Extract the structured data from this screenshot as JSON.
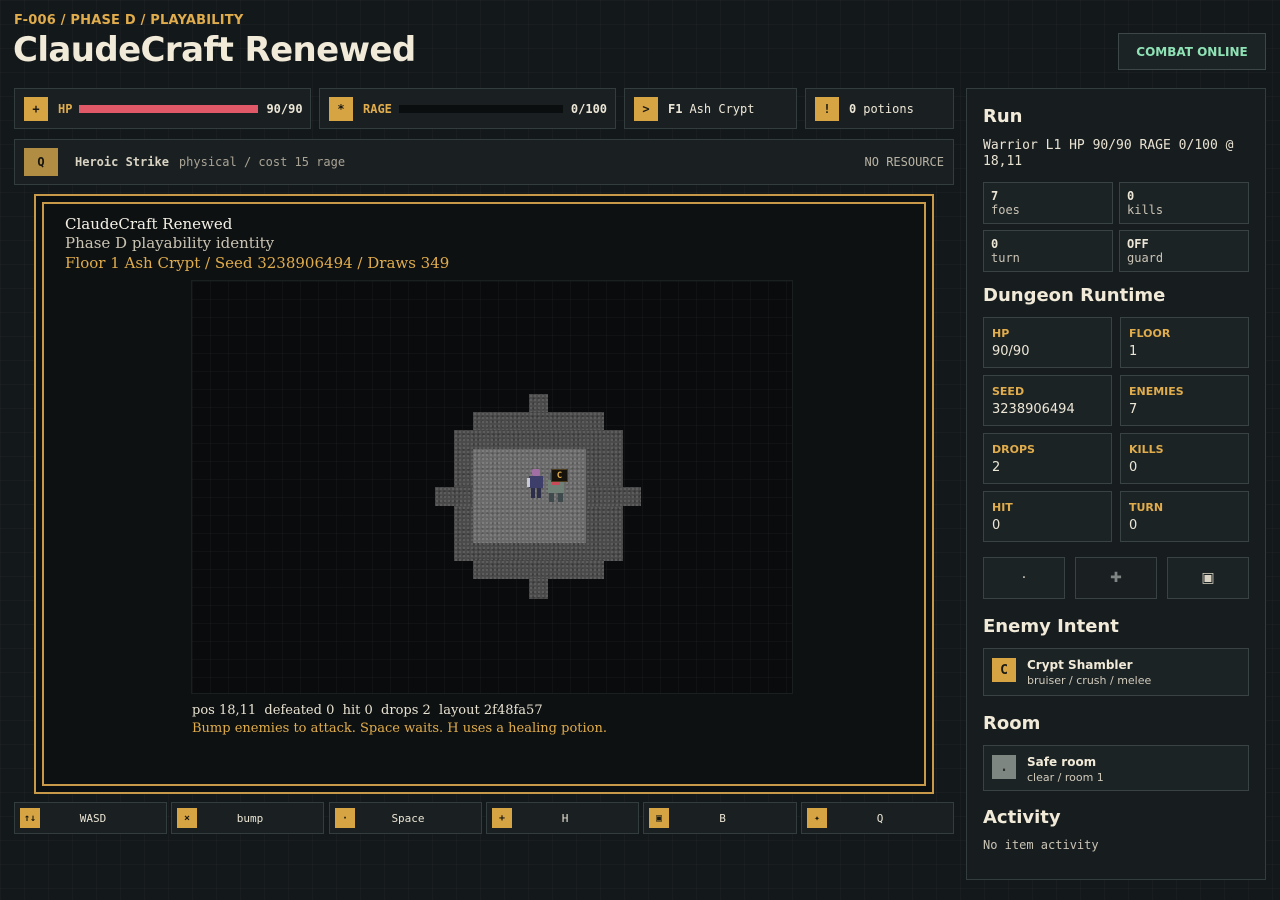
{
  "header": {
    "eyebrow": "F-006 / PHASE D / PLAYABILITY",
    "title": "ClaudeCraft Renewed",
    "status_button": "COMBAT ONLINE"
  },
  "stats": {
    "hp": {
      "badge": "+",
      "label": "HP",
      "value": "90/90",
      "fraction": 1.0,
      "color": "#e15868"
    },
    "rage": {
      "badge": "*",
      "label": "RAGE",
      "value": "0/100",
      "fraction": 0.0
    },
    "floor": {
      "badge": ">",
      "level": "F1",
      "name": "Ash Crypt"
    },
    "potions": {
      "badge": "!",
      "count": "0",
      "label": "potions"
    }
  },
  "ability": {
    "key": "Q",
    "name": "Heroic Strike",
    "detail": "physical / cost 15 rage",
    "status": "NO RESOURCE"
  },
  "viewport": {
    "title": "ClaudeCraft Renewed",
    "subtitle": "Phase D playability identity",
    "info": "Floor 1 Ash Crypt / Seed 3238906494 / Draws 349",
    "status_line": "pos 18,11  defeated 0  hit 0  drops 2  layout 2f48fa57",
    "hint": "Bump enemies to attack. Space waits. H uses a healing potion.",
    "enemy_marker": "C",
    "accent": "#e0ac4c"
  },
  "keys": [
    {
      "icon": "↑↓",
      "label": "WASD"
    },
    {
      "icon": "×",
      "label": "bump"
    },
    {
      "icon": "·",
      "label": "Space"
    },
    {
      "icon": "+",
      "label": "H"
    },
    {
      "icon": "▣",
      "label": "B"
    },
    {
      "icon": "✦",
      "label": "Q"
    }
  ],
  "panel": {
    "run_heading": "Run",
    "run_summary": "Warrior L1 HP 90/90 RAGE 0/100 @ 18,11",
    "run_stats": [
      {
        "value": "7",
        "label": "foes"
      },
      {
        "value": "0",
        "label": "kills"
      },
      {
        "value": "0",
        "label": "turn"
      },
      {
        "value": "OFF",
        "label": "guard"
      }
    ],
    "runtime_heading": "Dungeon Runtime",
    "runtime": [
      {
        "key": "HP",
        "value": "90/90"
      },
      {
        "key": "FLOOR",
        "value": "1"
      },
      {
        "key": "SEED",
        "value": "3238906494"
      },
      {
        "key": "ENEMIES",
        "value": "7"
      },
      {
        "key": "DROPS",
        "value": "2"
      },
      {
        "key": "KILLS",
        "value": "0"
      },
      {
        "key": "HIT",
        "value": "0"
      },
      {
        "key": "TURN",
        "value": "0"
      }
    ],
    "action_buttons": [
      "·",
      "✚",
      "▣"
    ],
    "intent_heading": "Enemy Intent",
    "intent": {
      "icon": "C",
      "name": "Crypt Shambler",
      "detail": "bruiser / crush / melee"
    },
    "room_heading": "Room",
    "room": {
      "icon": ".",
      "name": "Safe room",
      "detail": "clear / room 1"
    },
    "activity_heading": "Activity",
    "activity": "No item activity"
  }
}
